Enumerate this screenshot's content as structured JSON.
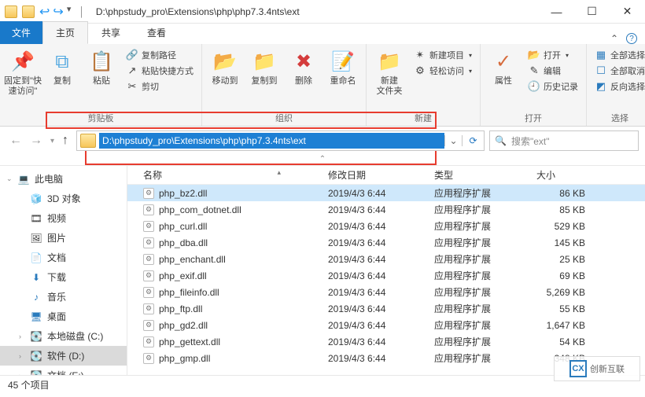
{
  "window": {
    "title": "D:\\phpstudy_pro\\Extensions\\php\\php7.3.4nts\\ext",
    "address_path": "D:\\phpstudy_pro\\Extensions\\php\\php7.3.4nts\\ext",
    "search_placeholder": "搜索\"ext\""
  },
  "tabs": {
    "file": "文件",
    "home": "主页",
    "share": "共享",
    "view": "查看"
  },
  "ribbon": {
    "pin": "固定到\"快\n速访问\"",
    "copy": "复制",
    "paste": "粘贴",
    "copy_path": "复制路径",
    "paste_shortcut": "粘贴快捷方式",
    "cut": "剪切",
    "group_clipboard": "剪贴板",
    "move_to": "移动到",
    "copy_to": "复制到",
    "delete": "删除",
    "rename": "重命名",
    "group_organize": "组织",
    "new_folder": "新建\n文件夹",
    "new_item": "新建项目",
    "easy_access": "轻松访问",
    "group_new": "新建",
    "properties": "属性",
    "open": "打开",
    "edit": "编辑",
    "history": "历史记录",
    "group_open": "打开",
    "select_all": "全部选择",
    "select_none": "全部取消",
    "invert": "反向选择",
    "group_select": "选择"
  },
  "sidebar": {
    "this_pc": "此电脑",
    "objects3d": "3D 对象",
    "videos": "视频",
    "pictures": "图片",
    "documents": "文档",
    "downloads": "下载",
    "music": "音乐",
    "desktop": "桌面",
    "drive_c": "本地磁盘 (C:)",
    "drive_d": "软件 (D:)",
    "drive_e": "文档 (E:)"
  },
  "columns": {
    "name": "名称",
    "date": "修改日期",
    "type": "类型",
    "size": "大小"
  },
  "file_type": "应用程序扩展",
  "files": [
    {
      "name": "php_bz2.dll",
      "date": "2019/4/3 6:44",
      "size": "86 KB",
      "selected": true
    },
    {
      "name": "php_com_dotnet.dll",
      "date": "2019/4/3 6:44",
      "size": "85 KB"
    },
    {
      "name": "php_curl.dll",
      "date": "2019/4/3 6:44",
      "size": "529 KB"
    },
    {
      "name": "php_dba.dll",
      "date": "2019/4/3 6:44",
      "size": "145 KB"
    },
    {
      "name": "php_enchant.dll",
      "date": "2019/4/3 6:44",
      "size": "25 KB"
    },
    {
      "name": "php_exif.dll",
      "date": "2019/4/3 6:44",
      "size": "69 KB"
    },
    {
      "name": "php_fileinfo.dll",
      "date": "2019/4/3 6:44",
      "size": "5,269 KB"
    },
    {
      "name": "php_ftp.dll",
      "date": "2019/4/3 6:44",
      "size": "55 KB"
    },
    {
      "name": "php_gd2.dll",
      "date": "2019/4/3 6:44",
      "size": "1,647 KB"
    },
    {
      "name": "php_gettext.dll",
      "date": "2019/4/3 6:44",
      "size": "54 KB"
    },
    {
      "name": "php_gmp.dll",
      "date": "2019/4/3 6:44",
      "size": "348 KB"
    }
  ],
  "status": {
    "count": "45 个项目"
  },
  "watermark": "创新互联"
}
